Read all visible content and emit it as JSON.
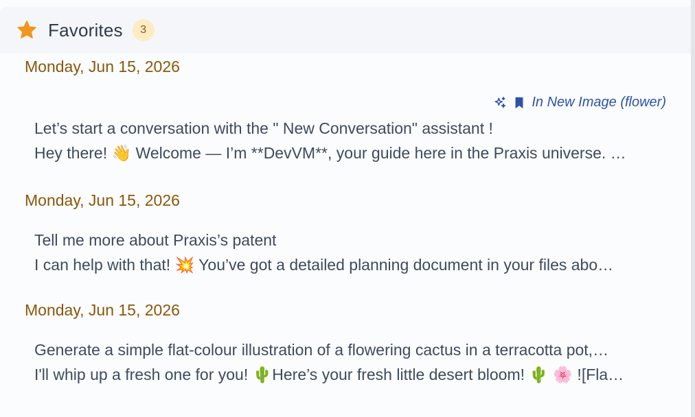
{
  "header": {
    "title": "Favorites",
    "count": "3"
  },
  "groups": [
    {
      "date": "Monday, Jun 15, 2026",
      "source": "In New Image (flower)",
      "prompt": "Let’s start a conversation with the \" New Conversation\" assistant !",
      "response": "Hey there! 👋 Welcome — I’m **DevVM**, your guide here in the Praxis universe. …"
    },
    {
      "date": "Monday, Jun 15, 2026",
      "prompt": "Tell me more about Praxis’s patent",
      "response": "I can help with that! 💥 You’ve got a detailed planning document in your files abo…"
    },
    {
      "date": "Monday, Jun 15, 2026",
      "prompt": "Generate a simple flat-colour illustration of a flowering cactus in a terracotta pot,…",
      "response": "I'll whip up a fresh one for you! 🌵Here’s your fresh little desert bloom! 🌵 🌸 ![Fla…"
    }
  ],
  "colors": {
    "date": "#8a5708",
    "accent_link": "#2d51a8",
    "star": "#f0961c",
    "badge_bg": "#fdebc4"
  },
  "icons": {
    "header": "star-icon",
    "source": [
      "sparkles-icon",
      "bookmark-icon"
    ]
  }
}
